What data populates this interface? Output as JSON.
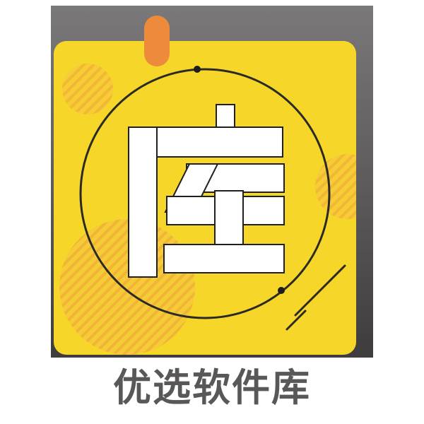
{
  "app": {
    "name": "优选软件库",
    "logo_glyph": "库"
  },
  "icon": {
    "name": "library-app-icon",
    "colors": {
      "frame": "#5f5d5e",
      "card": "#f7d62a",
      "glyph": "#ffffff",
      "glyph_outline": "#1f1f1f",
      "ring": "#2a2a28",
      "tab": "#ee8a3c",
      "decor": "#f2b63a"
    }
  }
}
